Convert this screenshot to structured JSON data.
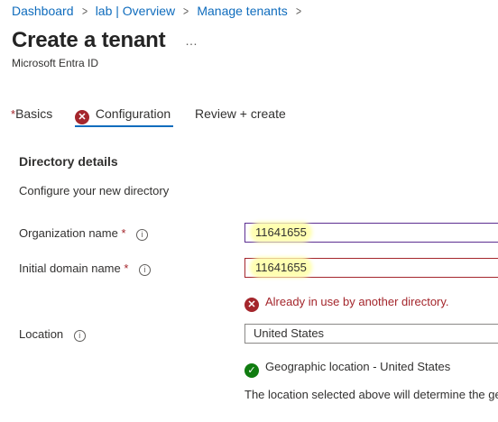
{
  "breadcrumb": {
    "items": [
      "Dashboard",
      "lab | Overview",
      "Manage tenants"
    ]
  },
  "header": {
    "title": "Create a tenant",
    "more": "…",
    "subtitle": "Microsoft Entra ID"
  },
  "tabs": [
    {
      "label": "Basics",
      "required_marker": "*"
    },
    {
      "label": "Configuration",
      "status": "error"
    },
    {
      "label": "Review + create"
    }
  ],
  "section": {
    "title": "Directory details",
    "description": "Configure your new directory"
  },
  "form": {
    "org_name": {
      "label": "Organization name",
      "required_marker": "*",
      "value": "11641655"
    },
    "domain_name": {
      "label": "Initial domain name",
      "required_marker": "*",
      "value": "11641655",
      "error": "Already in use by another directory."
    },
    "location": {
      "label": "Location",
      "value": "United States",
      "status": "Geographic location - United States",
      "note": "The location selected above will determine the ge"
    }
  },
  "colors": {
    "accent": "#0f6cbd",
    "error": "#a4262c",
    "success": "#107c10",
    "highlight": "#ffffb0"
  }
}
